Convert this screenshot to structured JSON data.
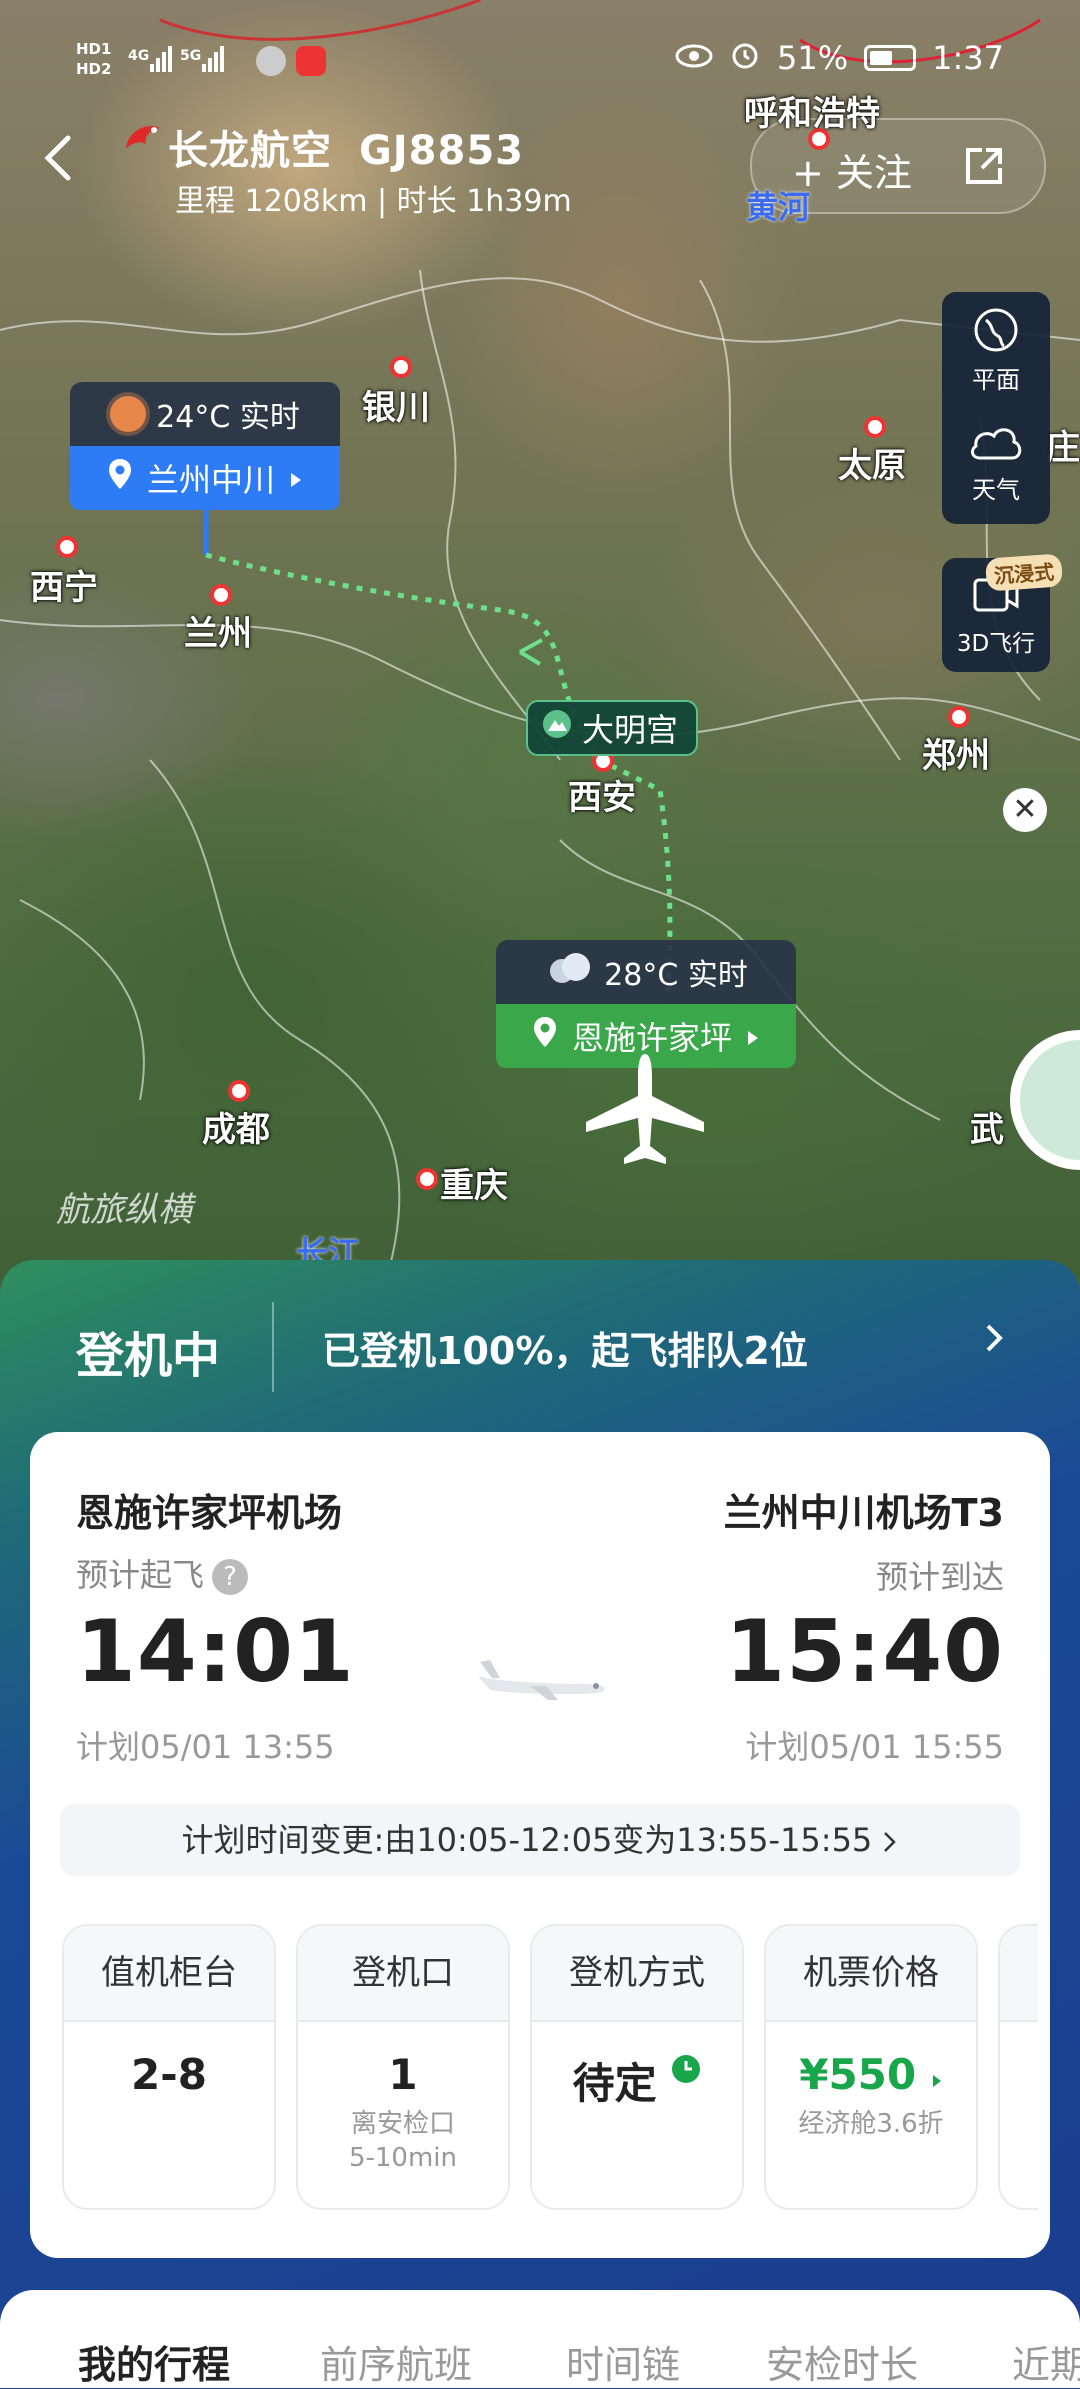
{
  "status_bar": {
    "network_left": "HD 4G 5G",
    "battery": "51%",
    "time": "1:37"
  },
  "header": {
    "airline": "长龙航空",
    "flight_no": "GJ8853",
    "subtitle": "里程 1208km | 时长 1h39m",
    "follow_label": "+ 关注"
  },
  "map": {
    "cities": [
      "呼和浩特",
      "银川",
      "太原",
      "西宁",
      "兰州",
      "西安",
      "郑州",
      "成都",
      "重庆",
      "武",
      "庄"
    ],
    "rivers": [
      "黄河",
      "长江"
    ],
    "landmark": "大明宫",
    "origin_weather": "24°C 实时",
    "origin_airport": "兰州中川",
    "dest_weather": "28°C 实时",
    "dest_airport": "恩施许家坪",
    "side_buttons": [
      "平面",
      "天气"
    ],
    "fly3d_label": "3D飞行",
    "immersive_badge": "沉浸式",
    "watermark": "航旅纵横",
    "close": "✕"
  },
  "status": {
    "main": "登机中",
    "detail": "已登机100%，起飞排队2位"
  },
  "flight": {
    "dep_airport": "恩施许家坪机场",
    "arr_airport": "兰州中川机场T3",
    "dep_label": "预计起飞",
    "arr_label": "预计到达",
    "dep_time": "14:01",
    "arr_time": "15:40",
    "dep_plan": "计划05/01 13:55",
    "arr_plan": "计划05/01 15:55",
    "change_notice": "计划时间变更:由10:05-12:05变为13:55-15:55"
  },
  "info": [
    {
      "label": "值机柜台",
      "value": "2-8",
      "sub": ""
    },
    {
      "label": "登机口",
      "value": "1",
      "sub": "离安检口\n5-10min"
    },
    {
      "label": "登机方式",
      "value": "待定",
      "sub": ""
    },
    {
      "label": "机票价格",
      "value": "¥550",
      "sub": "经济舱3.6折"
    }
  ],
  "tabs": [
    "我的行程",
    "前序航班",
    "时间链",
    "安检时长",
    "近期"
  ],
  "colors": {
    "accent_blue": "#2d7cf6",
    "dest_green": "#3aa84a",
    "price_green": "#19a64a"
  }
}
